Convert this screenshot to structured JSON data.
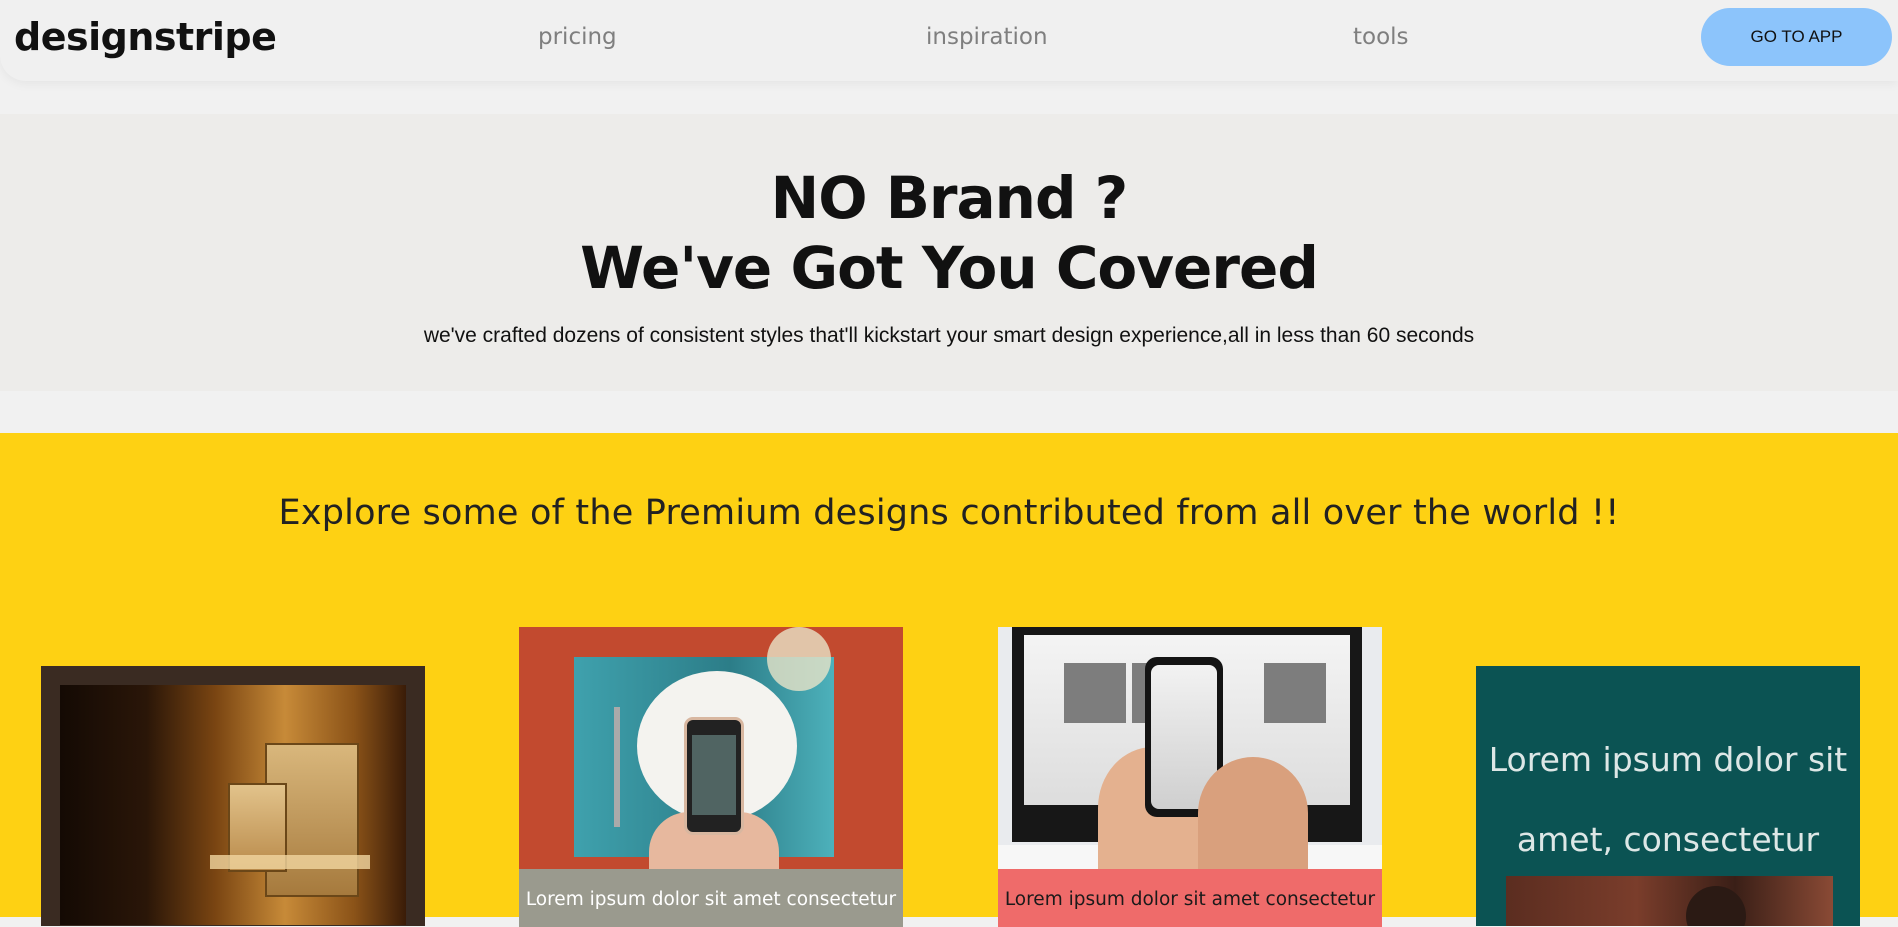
{
  "nav": {
    "logo": "designstripe",
    "links": [
      "pricing",
      "inspiration",
      "tools"
    ],
    "cta": "GO TO APP",
    "cta_color": "#8cc4fb"
  },
  "hero": {
    "line1": "NO Brand ?",
    "line2": "We've Got You Covered",
    "subtitle": "we've crafted dozens of consistent styles that'll kickstart your smart design experience,all in less than 60 seconds"
  },
  "explore": {
    "title": "Explore some of the Premium designs contributed from all over the world !!",
    "background": "#fed113",
    "cards": [
      {
        "caption": ""
      },
      {
        "caption": "Lorem ipsum dolor sit amet consectetur"
      },
      {
        "caption": "Lorem ipsum dolor sit amet consectetur"
      },
      {
        "text_line1": "Lorem ipsum dolor sit",
        "text_line2": "amet, consectetur"
      }
    ]
  }
}
